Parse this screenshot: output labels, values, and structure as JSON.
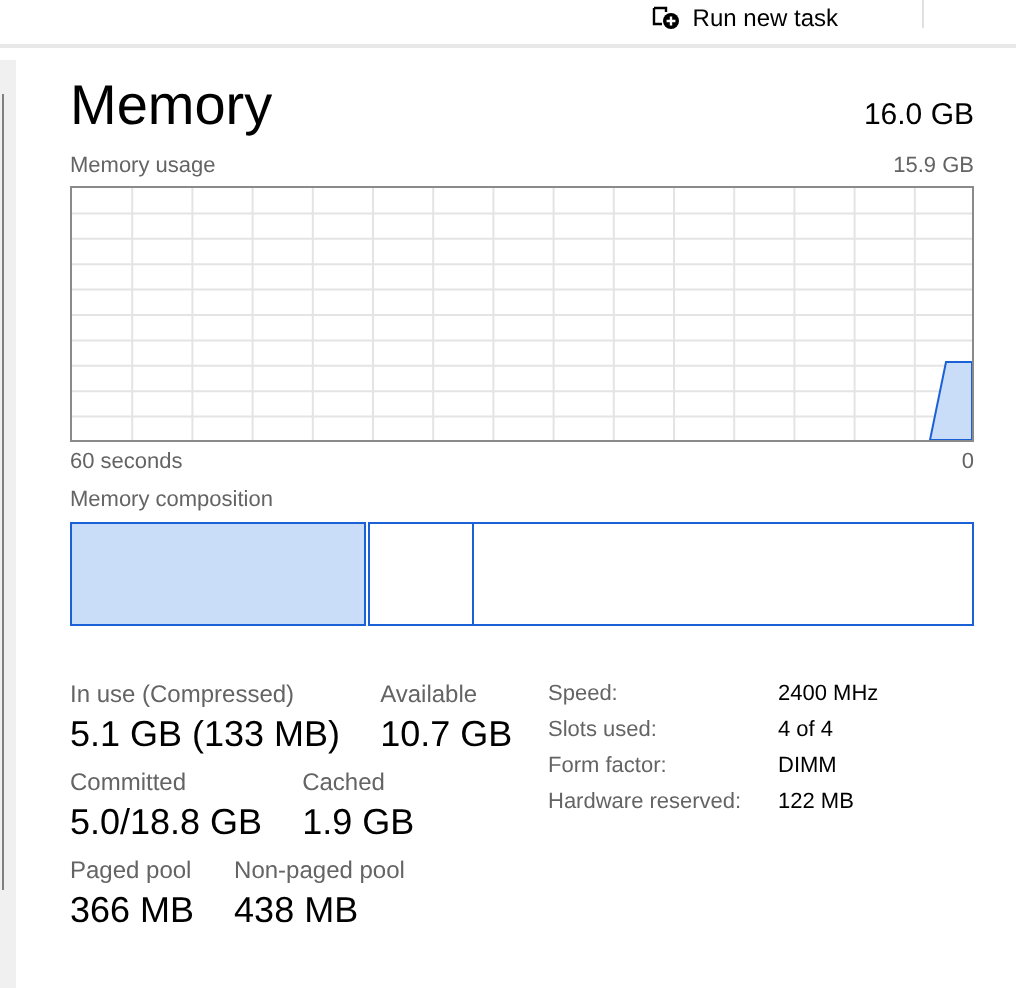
{
  "toolbar": {
    "run_new_task": "Run new task"
  },
  "header": {
    "title": "Memory",
    "total": "16.0 GB"
  },
  "usage_graph": {
    "label": "Memory usage",
    "max": "15.9 GB",
    "time_start": "60 seconds",
    "time_end": "0"
  },
  "composition": {
    "label": "Memory composition"
  },
  "stats": [
    [
      {
        "label": "In use (Compressed)",
        "value": "5.1 GB (133 MB)"
      },
      {
        "label": "Available",
        "value": "10.7 GB"
      }
    ],
    [
      {
        "label": "Committed",
        "value": "5.0/18.8 GB"
      },
      {
        "label": "Cached",
        "value": "1.9 GB"
      }
    ],
    [
      {
        "label": "Paged pool",
        "value": "366 MB"
      },
      {
        "label": "Non-paged pool",
        "value": "438 MB"
      }
    ]
  ],
  "details": [
    {
      "label": "Speed:",
      "value": "2400 MHz"
    },
    {
      "label": "Slots used:",
      "value": "4 of 4"
    },
    {
      "label": "Form factor:",
      "value": "DIMM"
    },
    {
      "label": "Hardware reserved:",
      "value": "122 MB"
    }
  ]
}
